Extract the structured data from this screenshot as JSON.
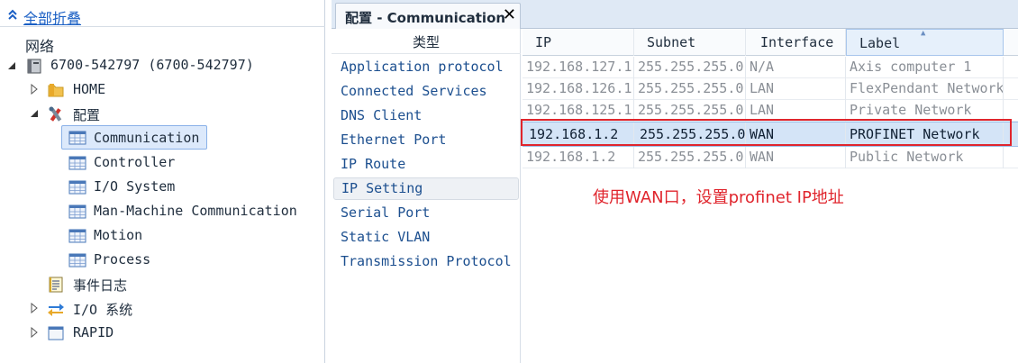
{
  "tree": {
    "collapse_all": "全部折叠",
    "items": [
      {
        "label": "网络"
      },
      {
        "label": "6700-542797 (6700-542797)"
      },
      {
        "label": "HOME"
      },
      {
        "label": "配置"
      },
      {
        "label": "Communication"
      },
      {
        "label": "Controller"
      },
      {
        "label": "I/O System"
      },
      {
        "label": "Man-Machine Communication"
      },
      {
        "label": "Motion"
      },
      {
        "label": "Process"
      },
      {
        "label": "事件日志"
      },
      {
        "label": "I/O 系统"
      },
      {
        "label": "RAPID"
      }
    ]
  },
  "tab": {
    "title": "配置 - Communication",
    "close": "✕"
  },
  "categories": {
    "header": "类型",
    "items": [
      "Application protocol",
      "Connected Services",
      "DNS Client",
      "Ethernet Port",
      "IP Route",
      "IP Setting",
      "Serial Port",
      "Static VLAN",
      "Transmission Protocol"
    ],
    "selected": "IP Setting"
  },
  "grid": {
    "columns": [
      "IP",
      "Subnet",
      "Interface",
      "Label"
    ],
    "sort_column": "Label",
    "rows": [
      {
        "ip": "192.168.127.1",
        "subnet": "255.255.255.0",
        "interface": "N/A",
        "label": "Axis computer 1"
      },
      {
        "ip": "192.168.126.1",
        "subnet": "255.255.255.0",
        "interface": "LAN",
        "label": "FlexPendant Network"
      },
      {
        "ip": "192.168.125.1",
        "subnet": "255.255.255.0",
        "interface": "LAN",
        "label": "Private Network"
      },
      {
        "ip": "192.168.1.2",
        "subnet": "255.255.255.0",
        "interface": "WAN",
        "label": "PROFINET Network"
      },
      {
        "ip": "192.168.1.2",
        "subnet": "255.255.255.0",
        "interface": "WAN",
        "label": "Public Network"
      }
    ],
    "selected_row": 3
  },
  "annotation": "使用WAN口，设置profinet IP地址",
  "colors": {
    "accent_link": "#1a5fc4",
    "annotation_red": "#e0252d",
    "selection": "#d4e4f7"
  }
}
